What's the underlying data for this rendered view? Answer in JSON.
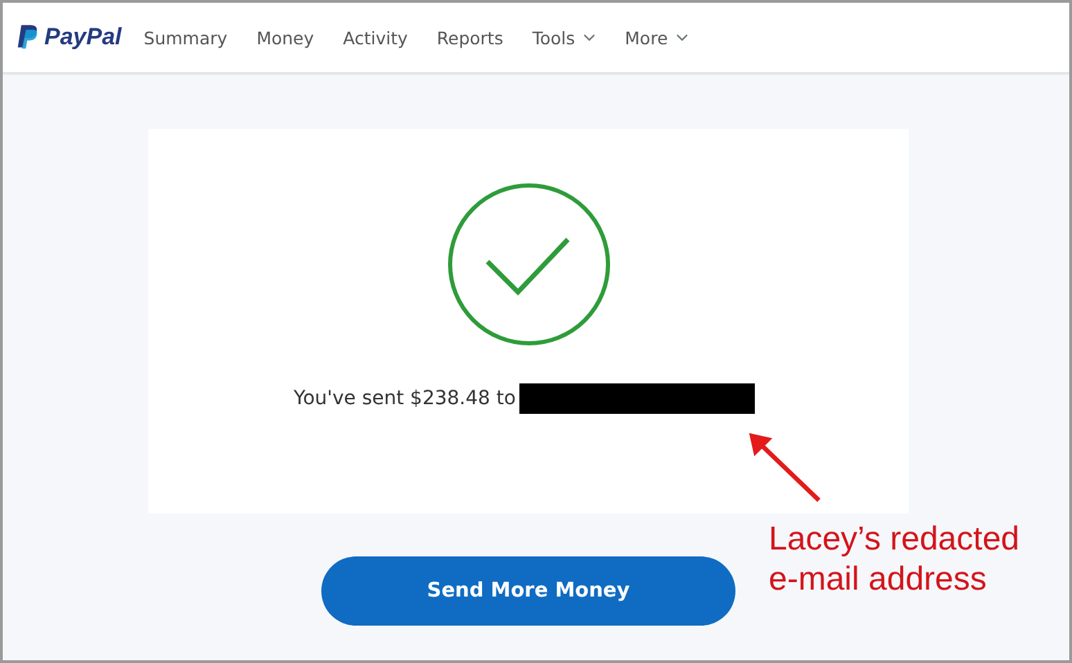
{
  "nav": {
    "logo": "PayPal",
    "items": [
      {
        "label": "Summary",
        "dropdown": false
      },
      {
        "label": "Money",
        "dropdown": false
      },
      {
        "label": "Activity",
        "dropdown": false
      },
      {
        "label": "Reports",
        "dropdown": false
      },
      {
        "label": "Tools",
        "dropdown": true
      },
      {
        "label": "More",
        "dropdown": true
      }
    ]
  },
  "confirmation": {
    "message": "You've sent $238.48 to",
    "recipient_redacted": true
  },
  "button": "Send More Money",
  "annotation": "Lacey’s redacted e-mail address"
}
